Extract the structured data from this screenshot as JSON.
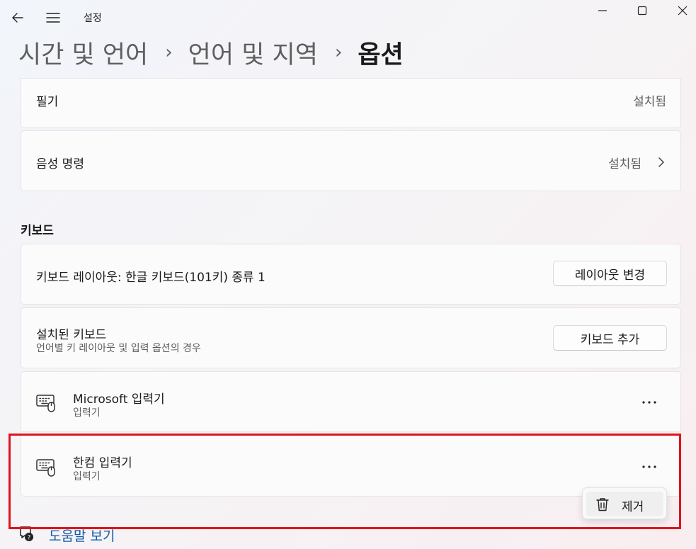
{
  "window": {
    "title": "설정",
    "buttons": {
      "minimize": "minimize-icon",
      "maximize": "maximize-icon",
      "close": "close-icon"
    }
  },
  "breadcrumb": {
    "items": [
      "시간 및 언어",
      "언어 및 지역",
      "옵션"
    ],
    "separator": "›"
  },
  "handwriting": {
    "label": "필기",
    "status": "설치됨"
  },
  "speech": {
    "label": "음성 명령",
    "status": "설치됨"
  },
  "keyboard_section": {
    "title": "키보드",
    "layout": {
      "label": "키보드 레이아웃: 한글 키보드(101키) 종류 1",
      "button": "레이아웃 변경"
    },
    "installed": {
      "title": "설치된 키보드",
      "description": "언어별 키 레이아웃 및 입력 옵션의 경우",
      "button": "키보드 추가"
    },
    "keyboards": [
      {
        "name": "Microsoft 입력기",
        "type": "입력기"
      },
      {
        "name": "한컴 입력기",
        "type": "입력기"
      }
    ]
  },
  "context_menu": {
    "remove": "제거"
  },
  "help": {
    "label": "도움말 보기"
  },
  "colors": {
    "accent_link": "#0f5aa8",
    "highlight_border": "#e0131d"
  }
}
